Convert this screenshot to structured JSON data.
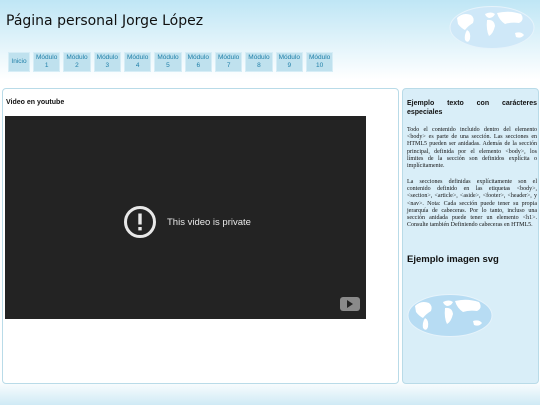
{
  "header": {
    "title": "Página personal Jorge López",
    "globe_icon": "world-map-globe-icon"
  },
  "nav": {
    "items": [
      {
        "label": "Inicio",
        "num": ""
      },
      {
        "label": "Módulo",
        "num": "1"
      },
      {
        "label": "Módulo",
        "num": "2"
      },
      {
        "label": "Módulo",
        "num": "3"
      },
      {
        "label": "Módulo",
        "num": "4"
      },
      {
        "label": "Módulo",
        "num": "5"
      },
      {
        "label": "Módulo",
        "num": "6"
      },
      {
        "label": "Módulo",
        "num": "7"
      },
      {
        "label": "Módulo",
        "num": "8"
      },
      {
        "label": "Módulo",
        "num": "9"
      },
      {
        "label": "Módulo",
        "num": "10"
      }
    ]
  },
  "main": {
    "heading": "Video en youtube",
    "video_message": "This video is private"
  },
  "aside": {
    "heading": "Ejemplo texto con carácteres especiales",
    "paragraph1": "Todo el contenido incluido dentro del elemento <body> es parte de una sección. Las secciones en HTML5 pueden ser anidadas. Además de la sección principal, definida por el elemento <body>, los límites de la sección son definidos explícita o implícitamente.",
    "paragraph2": "La secciones definidas explícitamente son el contenido definido en las etiquetas <body>, <section>, <article>, <aside>, <footer>, <header>, y <nav>. Nota: Cada sección puede tener su propia jerarquía de cabeceras. Por lo tanto, incluso una sección anidada puede tener un elemento <h1>. Consulte también Definiendo cabeceras en HTML5.",
    "svg_heading": "Ejemplo imagen svg"
  },
  "colors": {
    "nav_bg": "#bfe1ee",
    "nav_text": "#1f7fa8",
    "aside_bg": "#d9eef8",
    "video_bg": "#232323"
  }
}
